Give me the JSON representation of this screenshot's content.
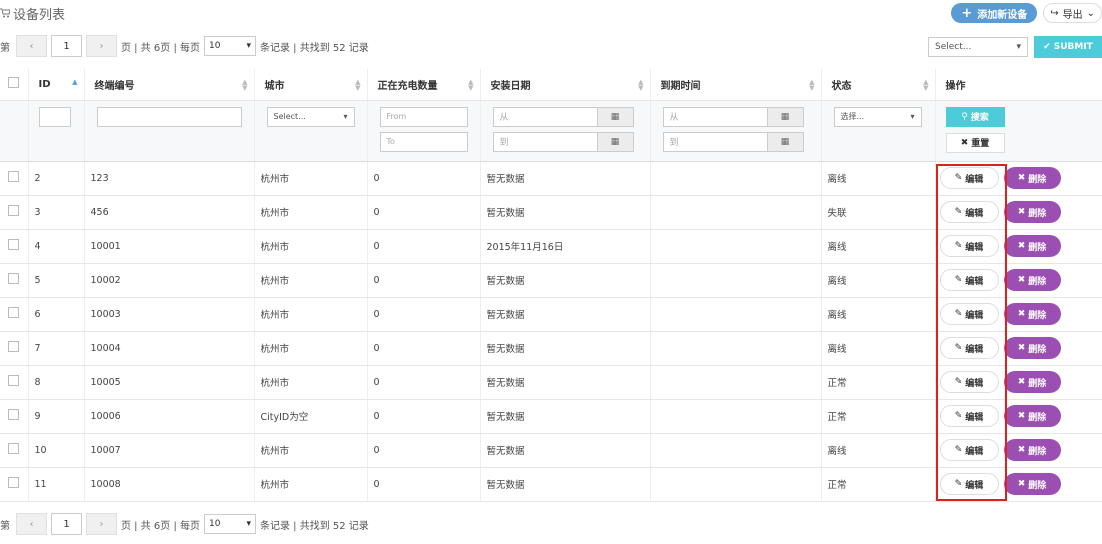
{
  "page": {
    "title": "设备列表",
    "add_button": "添加新设备",
    "export_button": "导出"
  },
  "pager": {
    "prefix": "第",
    "prev": "‹",
    "page": "1",
    "next": "›",
    "pages_text": "页 | 共 6页 | 每页",
    "per_page": "10",
    "records_text": "条记录 | 共找到 52 记录"
  },
  "toolbar": {
    "action_select": "Select...",
    "submit": "SUBMIT"
  },
  "columns": {
    "id": "ID",
    "terminal": "终端编号",
    "city": "城市",
    "charging": "正在充电数量",
    "install_date": "安装日期",
    "expire": "到期时间",
    "status": "状态",
    "actions": "操作"
  },
  "filters": {
    "city_select": "Select...",
    "from": "From",
    "to": "To",
    "date_from": "从",
    "date_to": "到",
    "status_select": "选择...",
    "search": "搜索",
    "reset": "重置"
  },
  "actions": {
    "edit": "编辑",
    "delete": "删除"
  },
  "rows": [
    {
      "id": "2",
      "terminal": "123",
      "city": "杭州市",
      "charging": "0",
      "install": "暂无数据",
      "expire": "",
      "status": "离线"
    },
    {
      "id": "3",
      "terminal": "456",
      "city": "杭州市",
      "charging": "0",
      "install": "暂无数据",
      "expire": "",
      "status": "失联"
    },
    {
      "id": "4",
      "terminal": "10001",
      "city": "杭州市",
      "charging": "0",
      "install": "2015年11月16日",
      "expire": "",
      "status": "离线"
    },
    {
      "id": "5",
      "terminal": "10002",
      "city": "杭州市",
      "charging": "0",
      "install": "暂无数据",
      "expire": "",
      "status": "离线"
    },
    {
      "id": "6",
      "terminal": "10003",
      "city": "杭州市",
      "charging": "0",
      "install": "暂无数据",
      "expire": "",
      "status": "离线"
    },
    {
      "id": "7",
      "terminal": "10004",
      "city": "杭州市",
      "charging": "0",
      "install": "暂无数据",
      "expire": "",
      "status": "离线"
    },
    {
      "id": "8",
      "terminal": "10005",
      "city": "杭州市",
      "charging": "0",
      "install": "暂无数据",
      "expire": "",
      "status": "正常"
    },
    {
      "id": "9",
      "terminal": "10006",
      "city": "CityID为空",
      "charging": "0",
      "install": "暂无数据",
      "expire": "",
      "status": "正常"
    },
    {
      "id": "10",
      "terminal": "10007",
      "city": "杭州市",
      "charging": "0",
      "install": "暂无数据",
      "expire": "",
      "status": "离线"
    },
    {
      "id": "11",
      "terminal": "10008",
      "city": "杭州市",
      "charging": "0",
      "install": "暂无数据",
      "expire": "",
      "status": "正常"
    }
  ],
  "colors": {
    "accent_teal": "#4ccbd9",
    "add_blue": "#5b9bd5",
    "delete_purple": "#9b4fb3",
    "highlight_red": "#e0201b"
  }
}
